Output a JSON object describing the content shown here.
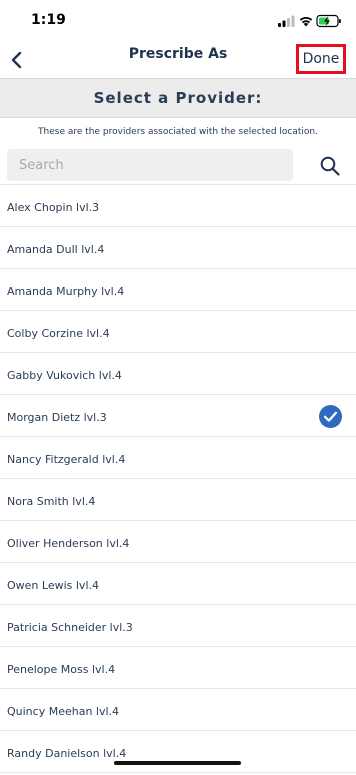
{
  "status_bar": {
    "time": "1:19"
  },
  "nav": {
    "title": "Prescribe As",
    "done_label": "Done"
  },
  "header": {
    "title": "Select a Provider:",
    "subtitle": "These are the providers associated with the selected location."
  },
  "search": {
    "placeholder": "Search",
    "value": ""
  },
  "colors": {
    "accent": "#2e6bbd",
    "done_outline": "#e3101f",
    "text": "#2a3d55"
  },
  "providers": [
    {
      "label": "Alex Chopin lvl.3",
      "selected": false
    },
    {
      "label": "Amanda Dull lvl.4",
      "selected": false
    },
    {
      "label": "Amanda Murphy lvl.4",
      "selected": false
    },
    {
      "label": "Colby Corzine lvl.4",
      "selected": false
    },
    {
      "label": "Gabby Vukovich lvl.4",
      "selected": false
    },
    {
      "label": "Morgan Dietz lvl.3",
      "selected": true
    },
    {
      "label": "Nancy Fitzgerald lvl.4",
      "selected": false
    },
    {
      "label": "Nora Smith lvl.4",
      "selected": false
    },
    {
      "label": "Oliver Henderson lvl.4",
      "selected": false
    },
    {
      "label": "Owen Lewis lvl.4",
      "selected": false
    },
    {
      "label": "Patricia Schneider lvl.3",
      "selected": false
    },
    {
      "label": "Penelope Moss lvl.4",
      "selected": false
    },
    {
      "label": "Quincy Meehan lvl.4",
      "selected": false
    },
    {
      "label": "Randy Danielson lvl.4",
      "selected": false
    }
  ]
}
